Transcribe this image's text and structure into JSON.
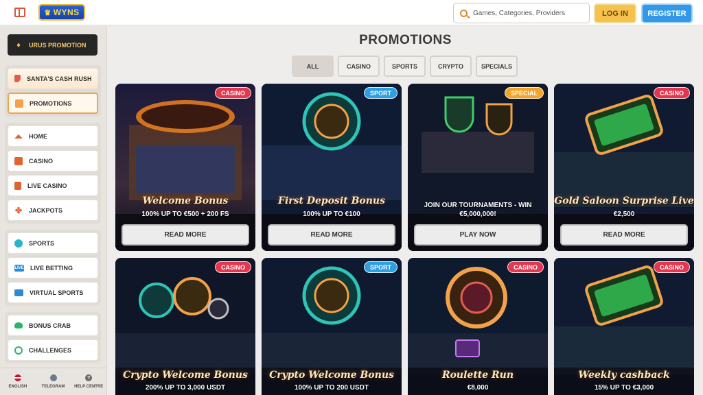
{
  "header": {
    "logo_text": "WYNS",
    "search_placeholder": "Games, Categories, Providers",
    "login_label": "LOG IN",
    "register_label": "REGISTER"
  },
  "sidebar": {
    "urus_promotion": "URUS PROMOTION",
    "featured": [
      {
        "label": "SANTA'S CASH RUSH",
        "icon": "sock-icon"
      },
      {
        "label": "PROMOTIONS",
        "icon": "gift-icon"
      }
    ],
    "casino_group": [
      {
        "label": "HOME",
        "icon": "home-icon"
      },
      {
        "label": "CASINO",
        "icon": "slot-machine-icon"
      },
      {
        "label": "LIVE CASINO",
        "icon": "card-icon"
      },
      {
        "label": "JACKPOTS",
        "icon": "clover-icon"
      }
    ],
    "sports_group": [
      {
        "label": "SPORTS",
        "icon": "ball-icon"
      },
      {
        "label": "LIVE BETTING",
        "icon": "live-icon"
      },
      {
        "label": "VIRTUAL SPORTS",
        "icon": "screen-icon"
      }
    ],
    "extras_group": [
      {
        "label": "BONUS CRAB",
        "icon": "crab-icon"
      },
      {
        "label": "CHALLENGES",
        "icon": "medal-icon"
      }
    ],
    "footer": [
      {
        "label": "ENGLISH",
        "icon": "flag-icon"
      },
      {
        "label": "TELEGRAM",
        "icon": "telegram-icon"
      },
      {
        "label": "HELP CENTRE",
        "icon": "help-icon",
        "glyph": "?"
      }
    ]
  },
  "main": {
    "title": "PROMOTIONS",
    "filters": [
      "ALL",
      "CASINO",
      "SPORTS",
      "CRYPTO",
      "SPECIALS"
    ],
    "active_filter": "ALL",
    "cards": [
      {
        "badge": "CASINO",
        "title": "Welcome Bonus",
        "subtitle": "100% UP TO €500 + 200 FS",
        "button": "READ MORE"
      },
      {
        "badge": "SPORT",
        "title": "First Deposit Bonus",
        "subtitle": "100% UP TO €100",
        "button": "READ MORE"
      },
      {
        "badge": "SPECIAL",
        "title": "JOIN OUR TOURNAMENTS - WIN €5,000,000!",
        "subtitle": "",
        "button": "PLAY NOW"
      },
      {
        "badge": "CASINO",
        "title": "Gold Saloon Surprise Live",
        "subtitle": "€2,500",
        "button": "READ MORE"
      },
      {
        "badge": "CASINO",
        "title": "Crypto Welcome Bonus",
        "subtitle": "200% UP TO 3,000 USDT"
      },
      {
        "badge": "SPORT",
        "title": "Crypto Welcome Bonus",
        "subtitle": "100% UP TO 200 USDT"
      },
      {
        "badge": "CASINO",
        "title": "Roulette Run",
        "subtitle": "€8,000"
      },
      {
        "badge": "CASINO",
        "title": "Weekly cashback",
        "subtitle": "15% UP TO €3,000"
      }
    ]
  }
}
